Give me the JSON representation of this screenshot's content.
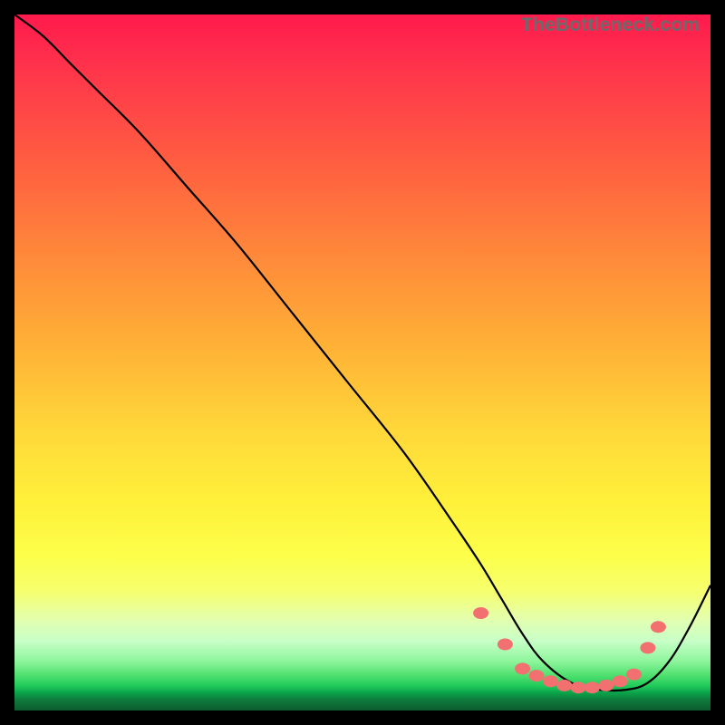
{
  "attribution": "TheBottleneck.com",
  "chart_data": {
    "type": "line",
    "title": "",
    "xlabel": "",
    "ylabel": "",
    "xlim": [
      0,
      100
    ],
    "ylim": [
      0,
      100
    ],
    "background": "red-yellow-green vertical gradient",
    "series": [
      {
        "name": "bottleneck-curve",
        "x": [
          0,
          4,
          8,
          12,
          18,
          25,
          32,
          40,
          48,
          56,
          63,
          67,
          70,
          73,
          76,
          80,
          84,
          88,
          91,
          94,
          97,
          100
        ],
        "y": [
          100,
          97,
          93,
          89,
          83,
          75,
          67,
          57,
          47,
          37,
          27,
          21,
          16,
          11,
          7,
          4,
          3,
          3,
          4,
          7,
          12,
          18
        ]
      }
    ],
    "markers": {
      "name": "highlighted-range",
      "points": [
        {
          "x": 67,
          "y": 14
        },
        {
          "x": 70.5,
          "y": 9.5
        },
        {
          "x": 73,
          "y": 6
        },
        {
          "x": 75,
          "y": 5
        },
        {
          "x": 77,
          "y": 4.2
        },
        {
          "x": 79,
          "y": 3.6
        },
        {
          "x": 81,
          "y": 3.3
        },
        {
          "x": 83,
          "y": 3.3
        },
        {
          "x": 85,
          "y": 3.6
        },
        {
          "x": 87,
          "y": 4.2
        },
        {
          "x": 89,
          "y": 5.2
        },
        {
          "x": 91,
          "y": 9
        },
        {
          "x": 92.5,
          "y": 12
        }
      ]
    }
  }
}
